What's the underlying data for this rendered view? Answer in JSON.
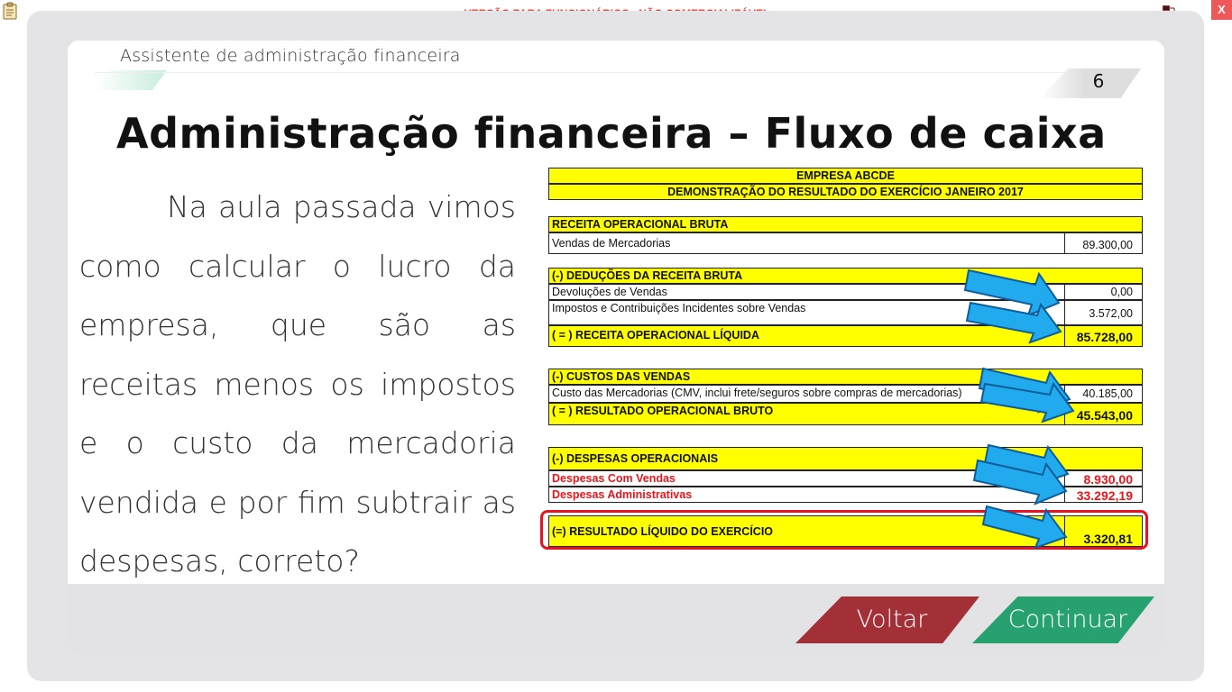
{
  "topbar": {
    "watermark": "VERSÃO PARA FUNCIONÁRIOS - NÃO COMERCIALIZÁVEL",
    "close_label": "X"
  },
  "header": {
    "app_title": "Assistente de administração financeira",
    "page_number": "6"
  },
  "main": {
    "heading": "Administração financeira – Fluxo de caixa",
    "body": "Na aula passada vimos como calcular o lucro da empresa, que são as receitas menos os impostos e o custo da mercadoria vendida e por fim subtrair as despesas, correto?"
  },
  "table": {
    "company": "EMPRESA ABCDE",
    "statement_title": "DEMONSTRAÇÃO DO RESULTADO DO EXERCÍCIO JANEIRO 2017",
    "receita_bruta_header": "RECEITA OPERACIONAL BRUTA",
    "vendas_label": "Vendas de Mercadorias",
    "vendas_value": "89.300,00",
    "deducoes_header": "(-) DEDUÇÕES DA RECEITA BRUTA",
    "devolucoes_label": "Devoluções de Vendas",
    "devolucoes_value": "0,00",
    "impostos_label": "Impostos e Contribuições Incidentes sobre Vendas",
    "impostos_value": "3.572,00",
    "receita_liquida_label": "( = ) RECEITA OPERACIONAL LÍQUIDA",
    "receita_liquida_value": "85.728,00",
    "custos_header": "(-) CUSTOS DAS VENDAS",
    "cmv_label": "Custo das Mercadorias  (CMV, inclui frete/seguros sobre compras de mercadorias)",
    "cmv_value": "40.185,00",
    "resultado_bruto_label": "( = ) RESULTADO OPERACIONAL BRUTO",
    "resultado_bruto_value": "45.543,00",
    "despesas_header": "(-) DESPESAS OPERACIONAIS",
    "despesas_vendas_label": "Despesas Com Vendas",
    "despesas_vendas_value": "8.930,00",
    "despesas_adm_label": "Despesas Administrativas",
    "despesas_adm_value": "33.292,19",
    "resultado_liquido_label": "(=) RESULTADO LÍQUIDO DO EXERCÍCIO",
    "resultado_liquido_value": "3.320,81"
  },
  "nav": {
    "back_label": "Voltar",
    "next_label": "Continuar"
  },
  "colors": {
    "highlight_yellow": "#ffff00",
    "arrow_blue": "#22aaee",
    "back_red": "#a32f37",
    "next_green": "#27a16f",
    "alert_red": "#e81222"
  }
}
